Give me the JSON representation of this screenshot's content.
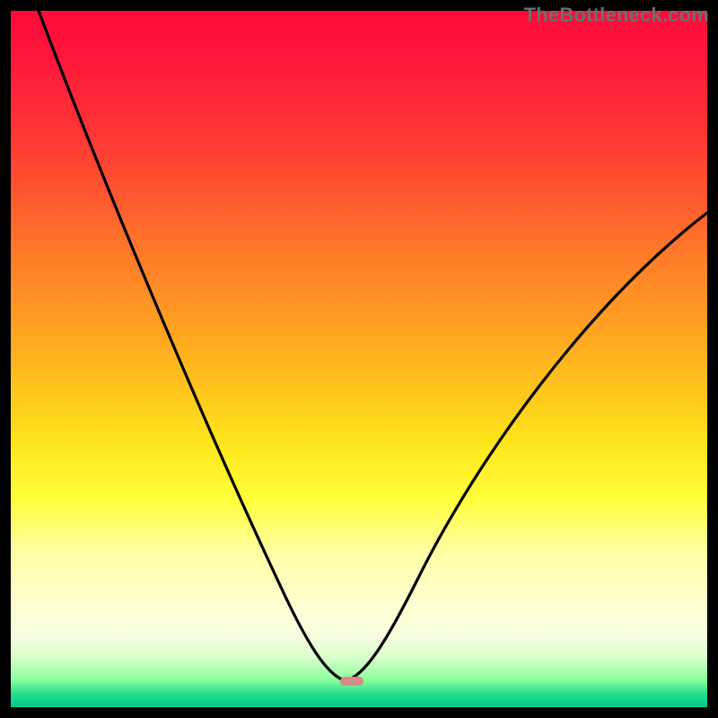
{
  "watermark": "TheBottleneck.com",
  "curve": {
    "min_x_frac": 0.48,
    "min_y_frac": 0.962,
    "left_start_x_frac": 0.04,
    "left_start_y_frac": 0.0,
    "right_end_x_frac": 1.0,
    "right_end_y_frac": 0.29
  },
  "marker": {
    "x_frac": 0.49,
    "y_frac": 0.962
  },
  "chart_data": {
    "type": "line",
    "title": "",
    "xlabel": "",
    "ylabel": "",
    "xlim": [
      0,
      1
    ],
    "ylim": [
      0,
      1
    ],
    "series": [
      {
        "name": "curve",
        "x": [
          0.04,
          0.1,
          0.16,
          0.22,
          0.28,
          0.34,
          0.4,
          0.44,
          0.47,
          0.48,
          0.5,
          0.54,
          0.6,
          0.68,
          0.78,
          0.88,
          1.0
        ],
        "y": [
          1.0,
          0.8,
          0.62,
          0.47,
          0.34,
          0.23,
          0.14,
          0.08,
          0.045,
          0.038,
          0.045,
          0.09,
          0.18,
          0.32,
          0.47,
          0.6,
          0.71
        ]
      }
    ],
    "annotations": [
      {
        "type": "marker",
        "x": 0.49,
        "y": 0.038,
        "label": "minimum",
        "color": "#d78a8a"
      }
    ]
  }
}
